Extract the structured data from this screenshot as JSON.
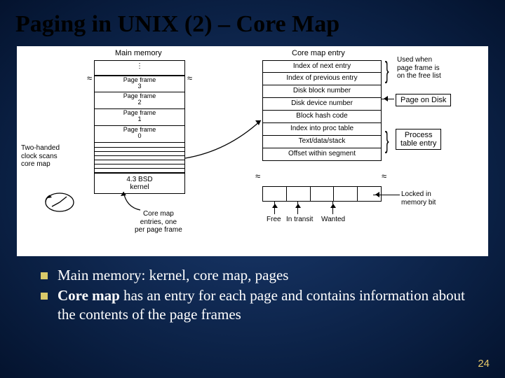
{
  "title": "Paging in UNIX (2) – Core Map",
  "diagram": {
    "main_memory_header": "Main memory",
    "core_map_entry_header": "Core map entry",
    "main_memory_cells": {
      "dots": "⋮",
      "pf3": "Page frame\n3",
      "pf2": "Page frame\n2",
      "pf1": "Page frame\n1",
      "pf0": "Page frame\n0",
      "kernel": "4.3 BSD\nkernel"
    },
    "cme_fields": [
      "Index of next entry",
      "Index of previous entry",
      "Disk block number",
      "Disk device number",
      "Block hash code",
      "Index into proc table",
      "Text/data/stack",
      "Offset within segment"
    ],
    "bit_labels": {
      "free": "Free",
      "intransit": "In transit",
      "wanted": "Wanted"
    },
    "annotations": {
      "freelist": "Used when\npage frame is\non the free list",
      "page_on_disk": "Page on Disk",
      "proc_table": "Process\ntable entry",
      "locked": "Locked in\nmemory bit",
      "clock": "Two-handed\nclock scans\ncore map",
      "coremap_entries": "Core map\nentries, one\nper page frame"
    }
  },
  "bullets": [
    {
      "text": "Main memory: kernel, core map, pages"
    },
    {
      "prefix": "Core map",
      "text": " has an entry for each page and contains information about the contents of the page frames"
    }
  ],
  "page_number": "24"
}
